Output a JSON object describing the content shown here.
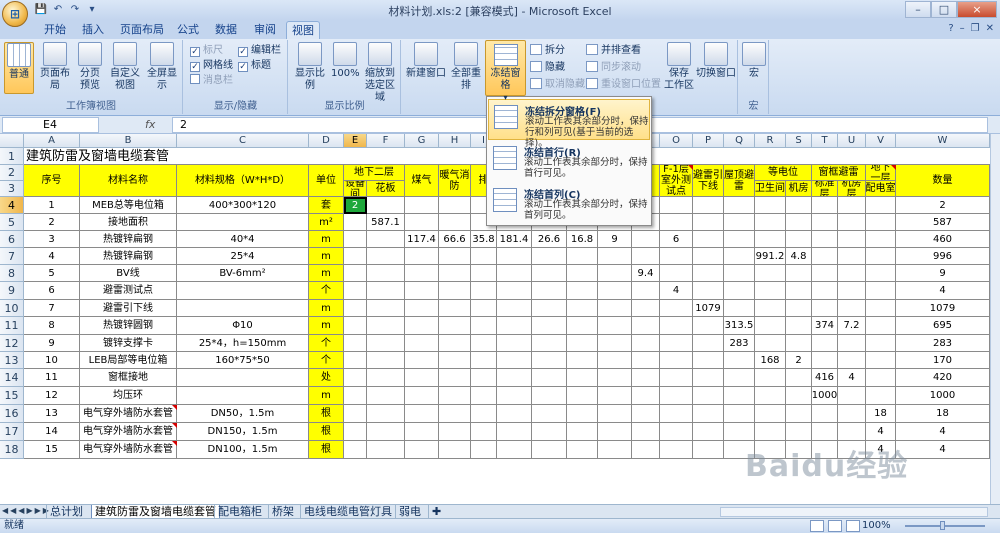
{
  "window": {
    "title": "材料计划.xls:2  [兼容模式] - Microsoft Excel",
    "controls": [
      "–",
      "□",
      "×"
    ]
  },
  "office_button": {
    "glyph": "⊞"
  },
  "qat": {
    "items": [
      "💾",
      "↶",
      "↷",
      "▾"
    ]
  },
  "tabs": [
    "开始",
    "插入",
    "页面布局",
    "公式",
    "数据",
    "审阅",
    "视图"
  ],
  "active_tab": "视图",
  "ribbon": {
    "workbook_views": {
      "label": "工作簿视图",
      "buttons": [
        "普通",
        "页面布局",
        "分页\n预览",
        "自定义\n视图",
        "全屏显示"
      ]
    },
    "show_hide": {
      "label": "显示/隐藏",
      "checks": [
        {
          "label": "标尺",
          "checked": true,
          "disabled": true
        },
        {
          "label": "编辑栏",
          "checked": true,
          "disabled": false
        },
        {
          "label": "网格线",
          "checked": true,
          "disabled": false
        },
        {
          "label": "标题",
          "checked": true,
          "disabled": false
        },
        {
          "label": "消息栏",
          "checked": false,
          "disabled": true
        }
      ]
    },
    "zoom": {
      "label": "显示比例",
      "buttons": [
        "显示比例",
        "100%",
        "缩放到\n选定区域"
      ]
    },
    "window": {
      "label": "窗口",
      "buttons": [
        "新建窗口",
        "全部重排",
        "冻结窗格"
      ],
      "small": [
        {
          "label": "拆分",
          "disabled": false
        },
        {
          "label": "隐藏",
          "disabled": false
        },
        {
          "label": "取消隐藏",
          "disabled": true
        },
        {
          "label": "并排查看",
          "disabled": false
        },
        {
          "label": "同步滚动",
          "disabled": true
        },
        {
          "label": "重设窗口位置",
          "disabled": true
        }
      ],
      "more": [
        "保存\n工作区",
        "切换窗口"
      ]
    },
    "macro": {
      "label": "宏",
      "button": "宏"
    }
  },
  "freeze_menu": {
    "items": [
      {
        "title": "冻结拆分窗格(F)",
        "desc": "滚动工作表其余部分时，保持行和列可见(基于当前的选择)。",
        "highlight": true
      },
      {
        "title": "冻结首行(R)",
        "desc": "滚动工作表其余部分时，保持首行可见。",
        "highlight": false
      },
      {
        "title": "冻结首列(C)",
        "desc": "滚动工作表其余部分时，保持首列可见。",
        "highlight": false
      }
    ]
  },
  "formula_bar": {
    "namebox": "E4",
    "fx": "fx",
    "value": "2"
  },
  "columns": [
    "A",
    "B",
    "C",
    "D",
    "E",
    "F",
    "G",
    "H",
    "I",
    "J",
    "K",
    "L",
    "M",
    "N",
    "O",
    "P",
    "Q",
    "R",
    "S",
    "T",
    "U",
    "V",
    "W"
  ],
  "rows": [
    "1",
    "2",
    "3",
    "4",
    "5",
    "6",
    "7",
    "8",
    "9",
    "10",
    "11",
    "12",
    "13",
    "14",
    "15",
    "16",
    "17",
    "18"
  ],
  "sheet": {
    "title": "建筑防雷及窗墙电缆套管",
    "headers": {
      "seq": "序号",
      "name": "材料名称",
      "spec": "材料规格（W*H*D）",
      "unit": "单位",
      "basement2": "地下二层",
      "equip_room": "设备间",
      "ceiling": "花板",
      "gas": "煤气",
      "heating": "暖气消防",
      "drain": "排",
      "n_col": "电",
      "o_col": "F-1层室外测试点",
      "p_col": "避雷引下线",
      "q_col": "屋顶避雷",
      "equipotential": "等电位",
      "toilet": "卫生间",
      "machine_room": "机房",
      "window_lightning": "窗框避雷",
      "std_floor": "标准层",
      "machine_floor": "机房层",
      "basement1": "地下一层",
      "power_room": "配电室",
      "qty": "数量"
    },
    "data": [
      {
        "seq": "1",
        "name": "MEB总等电位箱",
        "spec": "400*300*120",
        "unit": "套",
        "E": "2",
        "F": "",
        "G": "",
        "H": "",
        "I": "",
        "J": "",
        "K": "",
        "L": "",
        "M": "",
        "N": "",
        "O": "",
        "P": "",
        "Q": "",
        "R": "",
        "S": "",
        "T": "",
        "U": "",
        "V": "",
        "W": "2"
      },
      {
        "seq": "2",
        "name": "接地面积",
        "spec": "",
        "unit": "m²",
        "E": "",
        "F": "587.1",
        "G": "",
        "H": "",
        "I": "",
        "J": "",
        "K": "",
        "L": "",
        "M": "",
        "N": "",
        "O": "",
        "P": "",
        "Q": "",
        "R": "",
        "S": "",
        "T": "",
        "U": "",
        "V": "",
        "W": "587"
      },
      {
        "seq": "3",
        "name": "热镀锌扁钢",
        "spec": "40*4",
        "unit": "m",
        "E": "",
        "F": "",
        "G": "117.4",
        "H": "66.6",
        "I": "35.8",
        "J": "181.4",
        "K": "26.6",
        "L": "16.8",
        "M": "9",
        "N": "",
        "O": "6",
        "P": "",
        "Q": "",
        "R": "",
        "S": "",
        "T": "",
        "U": "",
        "V": "",
        "W": "460"
      },
      {
        "seq": "4",
        "name": "热镀锌扁钢",
        "spec": "25*4",
        "unit": "m",
        "E": "",
        "F": "",
        "G": "",
        "H": "",
        "I": "",
        "J": "",
        "K": "",
        "L": "",
        "M": "",
        "N": "",
        "O": "",
        "P": "",
        "Q": "",
        "R": "991.2",
        "S": "4.8",
        "T": "",
        "U": "",
        "V": "",
        "W": "996"
      },
      {
        "seq": "5",
        "name": "BV线",
        "spec": "BV-6mm²",
        "unit": "m",
        "E": "",
        "F": "",
        "G": "",
        "H": "",
        "I": "",
        "J": "",
        "K": "",
        "L": "",
        "M": "",
        "N": "9.4",
        "O": "",
        "P": "",
        "Q": "",
        "R": "",
        "S": "",
        "T": "",
        "U": "",
        "V": "",
        "W": "9"
      },
      {
        "seq": "6",
        "name": "避雷测试点",
        "spec": "",
        "unit": "个",
        "E": "",
        "F": "",
        "G": "",
        "H": "",
        "I": "",
        "J": "",
        "K": "",
        "L": "",
        "M": "",
        "N": "",
        "O": "4",
        "P": "",
        "Q": "",
        "R": "",
        "S": "",
        "T": "",
        "U": "",
        "V": "",
        "W": "4"
      },
      {
        "seq": "7",
        "name": "避雷引下线",
        "spec": "",
        "unit": "m",
        "E": "",
        "F": "",
        "G": "",
        "H": "",
        "I": "",
        "J": "",
        "K": "",
        "L": "",
        "M": "",
        "N": "",
        "O": "",
        "P": "1079",
        "Q": "",
        "R": "",
        "S": "",
        "T": "",
        "U": "",
        "V": "",
        "W": "1079"
      },
      {
        "seq": "8",
        "name": "热镀锌圆钢",
        "spec": "Φ10",
        "unit": "m",
        "E": "",
        "F": "",
        "G": "",
        "H": "",
        "I": "",
        "J": "",
        "K": "",
        "L": "",
        "M": "",
        "N": "",
        "O": "",
        "P": "",
        "Q": "313.5",
        "R": "",
        "S": "",
        "T": "374",
        "U": "7.2",
        "V": "",
        "W": "695"
      },
      {
        "seq": "9",
        "name": "镀锌支撑卡",
        "spec": "25*4，h=150mm",
        "unit": "个",
        "E": "",
        "F": "",
        "G": "",
        "H": "",
        "I": "",
        "J": "",
        "K": "",
        "L": "",
        "M": "",
        "N": "",
        "O": "",
        "P": "",
        "Q": "283",
        "R": "",
        "S": "",
        "T": "",
        "U": "",
        "V": "",
        "W": "283"
      },
      {
        "seq": "10",
        "name": "LEB局部等电位箱",
        "spec": "160*75*50",
        "unit": "个",
        "E": "",
        "F": "",
        "G": "",
        "H": "",
        "I": "",
        "J": "",
        "K": "",
        "L": "",
        "M": "",
        "N": "",
        "O": "",
        "P": "",
        "Q": "",
        "R": "168",
        "S": "2",
        "T": "",
        "U": "",
        "V": "",
        "W": "170"
      },
      {
        "seq": "11",
        "name": "窗框接地",
        "spec": "",
        "unit": "处",
        "E": "",
        "F": "",
        "G": "",
        "H": "",
        "I": "",
        "J": "",
        "K": "",
        "L": "",
        "M": "",
        "N": "",
        "O": "",
        "P": "",
        "Q": "",
        "R": "",
        "S": "",
        "T": "416",
        "U": "4",
        "V": "",
        "W": "420"
      },
      {
        "seq": "12",
        "name": "均压环",
        "spec": "",
        "unit": "m",
        "E": "",
        "F": "",
        "G": "",
        "H": "",
        "I": "",
        "J": "",
        "K": "",
        "L": "",
        "M": "",
        "N": "",
        "O": "",
        "P": "",
        "Q": "",
        "R": "",
        "S": "",
        "T": "1000",
        "U": "",
        "V": "",
        "W": "1000"
      },
      {
        "seq": "13",
        "name": "电气穿外墙防水套管",
        "spec": "DN50，1.5m",
        "unit": "根",
        "E": "",
        "F": "",
        "G": "",
        "H": "",
        "I": "",
        "J": "",
        "K": "",
        "L": "",
        "M": "",
        "N": "",
        "O": "",
        "P": "",
        "Q": "",
        "R": "",
        "S": "",
        "T": "",
        "U": "",
        "V": "18",
        "W": "18"
      },
      {
        "seq": "14",
        "name": "电气穿外墙防水套管",
        "spec": "DN150，1.5m",
        "unit": "根",
        "E": "",
        "F": "",
        "G": "",
        "H": "",
        "I": "",
        "J": "",
        "K": "",
        "L": "",
        "M": "",
        "N": "",
        "O": "",
        "P": "",
        "Q": "",
        "R": "",
        "S": "",
        "T": "",
        "U": "",
        "V": "4",
        "W": "4"
      },
      {
        "seq": "15",
        "name": "电气穿外墙防水套管",
        "spec": "DN100，1.5m",
        "unit": "根",
        "E": "",
        "F": "",
        "G": "",
        "H": "",
        "I": "",
        "J": "",
        "K": "",
        "L": "",
        "M": "",
        "N": "",
        "O": "",
        "P": "",
        "Q": "",
        "R": "",
        "S": "",
        "T": "",
        "U": "",
        "V": "4",
        "W": "4"
      }
    ]
  },
  "sheet_tabs": [
    "总计划",
    "建筑防雷及窗墙电缆套管",
    "配电箱柜",
    "桥架",
    "电线电缆电管灯具",
    "弱电"
  ],
  "active_sheet": "建筑防雷及窗墙电缆套管",
  "status": {
    "ready": "就绪",
    "zoom": "100%"
  },
  "watermark": "Baidu经验",
  "colors": {
    "header_yellow": "#ffff00",
    "active_cell": "#1ea83b",
    "ribbon_blue": "#c9daf0"
  }
}
